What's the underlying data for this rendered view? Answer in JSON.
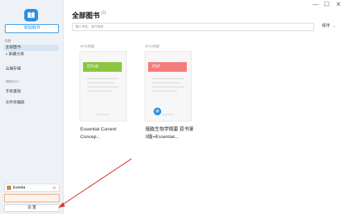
{
  "window": {
    "minimize": "—",
    "maximize": "☐",
    "close": "✕"
  },
  "sidebar": {
    "add_book_label": "添加图书",
    "section_books": "书籍",
    "all_books": "全部图书",
    "new_category": "新建分类",
    "cloud_storage": "云端存储",
    "phone": "手机使用",
    "file_transfer": "文件传输助",
    "user_name": "Eureka",
    "settings": "设 置"
  },
  "main": {
    "title": "全部图书",
    "count": "(2)",
    "search_placeholder": "输入书名、进行搜索",
    "sort_label": "排序"
  },
  "books": [
    {
      "read_time": "47小时前",
      "format": "EPUB",
      "title_lines": [
        "Essential Current",
        "Concep..."
      ],
      "color": "#8cc63f"
    },
    {
      "read_time": "47小时前",
      "format": "PDF",
      "title_lines": [
        "细胞生物学精要 原书第",
        "3版=Essential..."
      ],
      "color": "#f47c7c"
    }
  ],
  "colors": {
    "accent": "#2b8fe0",
    "arrow": "#d43a2f"
  }
}
